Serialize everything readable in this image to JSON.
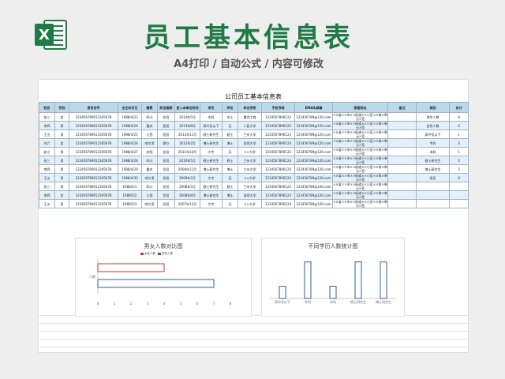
{
  "banner": {
    "title": "员工基本信息表",
    "subtitle": "A4打印 / 自动公式 / 内容可修改",
    "icon_letter": "X",
    "brand_color": "#1f7a45"
  },
  "sheet": {
    "title": "公司员工基本信息表",
    "columns": [
      "姓名",
      "性别",
      "身份证号",
      "出生年月日",
      "籍贯",
      "政治面貌",
      "进入本单位时间",
      "学历",
      "学位",
      "毕业学校",
      "手机号码",
      "EMAIL邮箱",
      "家庭地址",
      "备注",
      "类别",
      "合计"
    ],
    "rows": [
      [
        "张三",
        "女",
        "123456789012345678",
        "1988/4/23",
        "四川",
        "党员",
        "2014年5月",
        "本科",
        "学士",
        "重庆工商",
        "12345678901​23",
        "123456789@126.com",
        "××省××市××街道××小区××栋×单元×室",
        "",
        "男性人数",
        "8"
      ],
      [
        "李四",
        "男",
        "123456789012345678",
        "1988/4/24",
        "重庆",
        "团员",
        "2013年8月",
        "高中及以下",
        "无",
        "人民大学",
        "12345678901​24",
        "123456789@126.com",
        "××省××市××街道××小区××栋×单元×室",
        "",
        "女性人数",
        "4"
      ],
      [
        "王五",
        "男",
        "123456789012345678",
        "1988/4/25",
        "江西",
        "团员",
        "2012年11月",
        "硕士研究生",
        "硕士",
        "兰州大学",
        "12345678901​23",
        "123456789@126.com",
        "××省××市××街道××小区××栋×单元×室",
        "",
        "高中及以下",
        "1"
      ],
      [
        "刘六",
        "女",
        "123456789012345678",
        "1988/4/26",
        "哈尔滨",
        "群众",
        "2012年2月",
        "博士研究生",
        "博士",
        "深圳大学",
        "12345678901​24",
        "123456789@126.com",
        "××省××市××街道××小区××栋×单元×室",
        "",
        "专科",
        "3"
      ],
      [
        "赵七",
        "男",
        "123456789012345678",
        "1988/4/27",
        "庆阳",
        "党员",
        "2011年10月",
        "大专",
        "无",
        "××大学",
        "12345678901​23",
        "123456789@126.com",
        "××省××市××街道××小区××栋×单元×室",
        "",
        "本科",
        "1"
      ],
      [
        "张三",
        "男",
        "123456789012345678",
        "1988/4/28",
        "四川",
        "党员",
        "2010年5月",
        "硕士研究生",
        "硕士",
        "兰州大学",
        "12345678901​24",
        "123456789@126.com",
        "××省××市××街道××小区××栋×单元×室",
        "",
        "硕士研究生",
        "3"
      ],
      [
        "李四",
        "男",
        "123456789012345678",
        "1988/4/29",
        "重庆",
        "党员",
        "2009年11月",
        "博士研究生",
        "博士",
        "兰州大学",
        "12345678901​24",
        "123456789@126.com",
        "××省××市××街道××小区××栋×单元×室",
        "",
        "博士研究生",
        "3"
      ],
      [
        "王五",
        "男",
        "123456789012345678",
        "1988/4/30",
        "哈尔滨",
        "党员",
        "2009年2月",
        "大专",
        "无",
        "××大学",
        "12345678901​24",
        "123456789@126.com",
        "××省××市××街道××小区××栋×单元×室",
        "",
        "党员",
        "8"
      ],
      [
        "张三",
        "男",
        "123456789012345678",
        "1988/5/1",
        "四川",
        "党员",
        "2008年5月",
        "硕士研究生",
        "硕士",
        "兰州大学",
        "12345678901​23",
        "123456789@126.com",
        "××省××市××街道××小区××栋×单元×室",
        "",
        "",
        ""
      ],
      [
        "李四",
        "女",
        "123456789012345678",
        "1988/5/2",
        "江西",
        "党员",
        "2008年8月",
        "博士研究生",
        "博士",
        "深圳大学",
        "12345678901​23",
        "123456789@126.com",
        "××省××市××街道××小区××栋×单元×室",
        "",
        "",
        ""
      ],
      [
        "王五",
        "男",
        "123456789012345678",
        "1988/5/3",
        "哈尔滨",
        "党员",
        "2007年11月",
        "大专",
        "无",
        "××大学",
        "12345678901​24",
        "123456789@126.com",
        "××省××市××街道××小区××栋×单元×室",
        "",
        "",
        ""
      ]
    ]
  },
  "chart_data": [
    {
      "type": "bar",
      "title": "男女人数对比图",
      "orientation": "horizontal",
      "categories": [
        "人数"
      ],
      "series": [
        {
          "name": "女性人数",
          "values": [
            4
          ],
          "color": "#c0392b"
        },
        {
          "name": "男性人数",
          "values": [
            7
          ],
          "color": "#2e5f9e"
        }
      ],
      "xlim": [
        0,
        8
      ],
      "xticks": [
        "0",
        "1",
        "2",
        "3",
        "4",
        "5",
        "6",
        "7",
        "8"
      ]
    },
    {
      "type": "bar",
      "title": "不同学历人数统计图",
      "categories": [
        "高中及以下",
        "专科",
        "本科",
        "硕士研究生",
        "博士研究生"
      ],
      "values": [
        1,
        3,
        1,
        3,
        3
      ],
      "ylim": [
        0,
        3.5
      ],
      "bar_color": "#2e5f9e"
    }
  ]
}
